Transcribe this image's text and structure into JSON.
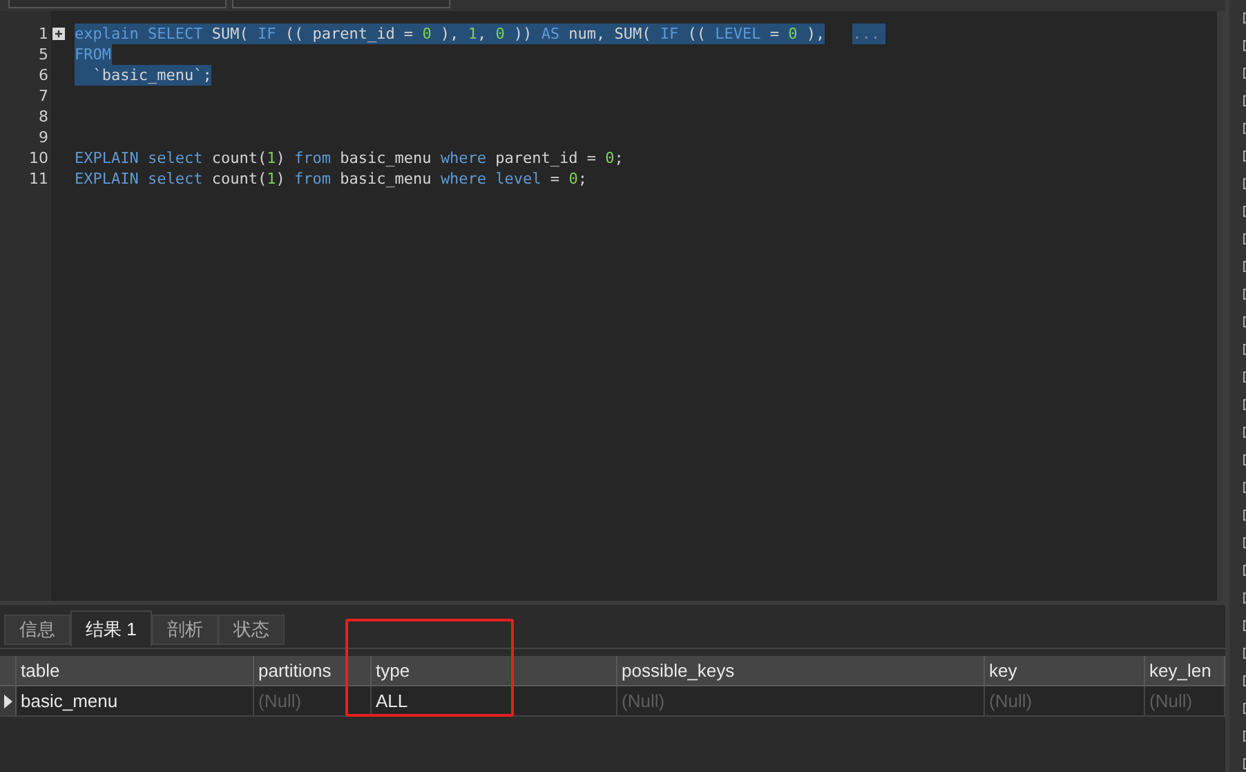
{
  "editor": {
    "lines": [
      {
        "number": "1",
        "selected": true,
        "foldable": true,
        "folded_marker": "...",
        "tokens": [
          {
            "kind": "keyword",
            "text": "explain"
          },
          {
            "kind": "keyword",
            "text": " SELECT"
          },
          {
            "kind": "plain",
            "text": " SUM( "
          },
          {
            "kind": "keyword",
            "text": "IF"
          },
          {
            "kind": "plain",
            "text": " (( parent_id = "
          },
          {
            "kind": "number",
            "text": "0"
          },
          {
            "kind": "plain",
            "text": " ), "
          },
          {
            "kind": "number",
            "text": "1"
          },
          {
            "kind": "plain",
            "text": ", "
          },
          {
            "kind": "number",
            "text": "0"
          },
          {
            "kind": "plain",
            "text": " )) "
          },
          {
            "kind": "keyword",
            "text": "AS"
          },
          {
            "kind": "plain",
            "text": " num, SUM( "
          },
          {
            "kind": "keyword",
            "text": "IF"
          },
          {
            "kind": "plain",
            "text": " (( "
          },
          {
            "kind": "keyword",
            "text": "LEVEL"
          },
          {
            "kind": "plain",
            "text": " = "
          },
          {
            "kind": "number",
            "text": "0"
          },
          {
            "kind": "plain",
            "text": " ),"
          }
        ]
      },
      {
        "number": "5",
        "selected": true,
        "tokens": [
          {
            "kind": "keyword",
            "text": "FROM"
          }
        ]
      },
      {
        "number": "6",
        "selected": true,
        "tokens": [
          {
            "kind": "plain",
            "text": "  `basic_menu`;"
          }
        ]
      },
      {
        "number": "7"
      },
      {
        "number": "8"
      },
      {
        "number": "9"
      },
      {
        "number": "10",
        "selected": false,
        "tokens": [
          {
            "kind": "keyword",
            "text": "EXPLAIN"
          },
          {
            "kind": "keyword",
            "text": " select"
          },
          {
            "kind": "plain",
            "text": " count("
          },
          {
            "kind": "number",
            "text": "1"
          },
          {
            "kind": "plain",
            "text": ") "
          },
          {
            "kind": "keyword",
            "text": "from"
          },
          {
            "kind": "plain",
            "text": " basic_menu "
          },
          {
            "kind": "keyword",
            "text": "where"
          },
          {
            "kind": "plain",
            "text": " parent_id = "
          },
          {
            "kind": "number",
            "text": "0"
          },
          {
            "kind": "plain",
            "text": ";"
          }
        ]
      },
      {
        "number": "11",
        "selected": false,
        "tokens": [
          {
            "kind": "keyword",
            "text": "EXPLAIN"
          },
          {
            "kind": "keyword",
            "text": " select"
          },
          {
            "kind": "plain",
            "text": " count("
          },
          {
            "kind": "number",
            "text": "1"
          },
          {
            "kind": "plain",
            "text": ") "
          },
          {
            "kind": "keyword",
            "text": "from"
          },
          {
            "kind": "plain",
            "text": " basic_menu "
          },
          {
            "kind": "keyword",
            "text": "where"
          },
          {
            "kind": "keyword",
            "text": " level"
          },
          {
            "kind": "plain",
            "text": " = "
          },
          {
            "kind": "number",
            "text": "0"
          },
          {
            "kind": "plain",
            "text": ";"
          }
        ]
      }
    ]
  },
  "result_tabs": [
    {
      "label": "信息",
      "selected": false
    },
    {
      "label": "结果 1",
      "selected": true
    },
    {
      "label": "剖析",
      "selected": false
    },
    {
      "label": "状态",
      "selected": false
    }
  ],
  "table": {
    "columns": [
      {
        "label": "table",
        "highlighted": false
      },
      {
        "label": "partitions",
        "highlighted": false
      },
      {
        "label": "type",
        "highlighted": true
      },
      {
        "label": "possible_keys",
        "highlighted": false
      },
      {
        "label": "key",
        "highlighted": false
      },
      {
        "label": "key_len",
        "highlighted": false
      }
    ],
    "rows": [
      {
        "current": true,
        "cells": [
          {
            "text": "basic_menu",
            "null": false
          },
          {
            "text": "(Null)",
            "null": true
          },
          {
            "text": "ALL",
            "null": false
          },
          {
            "text": "(Null)",
            "null": true
          },
          {
            "text": "(Null)",
            "null": true
          },
          {
            "text": "(Null)",
            "null": true
          }
        ]
      }
    ]
  }
}
